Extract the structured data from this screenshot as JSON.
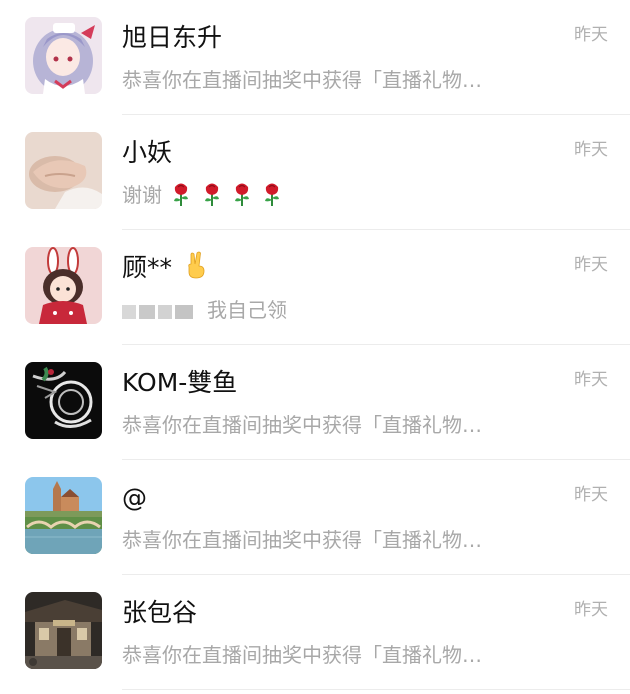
{
  "chats": [
    {
      "name": "旭日东升",
      "time": "昨天",
      "preview": "恭喜你在直播间抽奖中获得「直播礼物…",
      "avatar_icon": "anime-girl-avatar"
    },
    {
      "name": "小妖",
      "time": "昨天",
      "preview": "谢谢",
      "preview_emoji": "rose-icon",
      "preview_emoji_count": 4,
      "avatar_icon": "hand-photo-avatar"
    },
    {
      "name": "顾**",
      "name_emoji": "victory-hand-icon",
      "time": "昨天",
      "preview": "我自己领",
      "avatar_icon": "bunny-ears-girl-avatar"
    },
    {
      "name": "KOM-雙鱼",
      "time": "昨天",
      "preview": "恭喜你在直播间抽奖中获得「直播礼物…",
      "avatar_icon": "dark-art-avatar"
    },
    {
      "name": "@",
      "time": "昨天",
      "preview": "恭喜你在直播间抽奖中获得「直播礼物…",
      "avatar_icon": "landscape-bridge-avatar"
    },
    {
      "name": "张包谷",
      "time": "昨天",
      "preview": "恭喜你在直播间抽奖中获得「直播礼物…",
      "avatar_icon": "old-building-avatar"
    }
  ],
  "colors": {
    "name": "#111111",
    "preview": "#a8a8a8",
    "time": "#b0b0b0",
    "divider": "#ececec",
    "rose": "#c8102e"
  }
}
